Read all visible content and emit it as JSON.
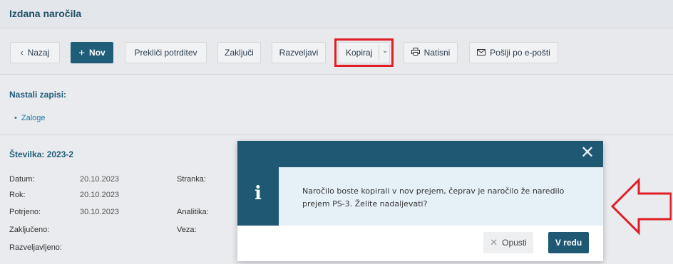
{
  "header": {
    "title": "Izdana naročila"
  },
  "toolbar": {
    "back_label": "Nazaj",
    "new_label": "Nov",
    "cancel_confirm_label": "Prekliči potrditev",
    "close_label": "Zaključi",
    "revert_label": "Razveljavi",
    "copy_label": "Kopiraj",
    "print_label": "Natisni",
    "email_label": "Pošlji po e-pošti"
  },
  "records": {
    "title": "Nastali zapisi:",
    "items": [
      "Zaloge"
    ]
  },
  "document": {
    "number": "Številka: 2023-2",
    "fields": [
      {
        "label": "Datum:",
        "value": "20.10.2023"
      },
      {
        "label": "Rok:",
        "value": "20.10.2023"
      },
      {
        "label": "Potrjeno:",
        "value": "30.10.2023"
      },
      {
        "label": "Zaključeno:",
        "value": ""
      },
      {
        "label": "Razveljavljeno:",
        "value": ""
      }
    ],
    "right_labels": [
      "Stranka:",
      "Analitika:",
      "Veza:"
    ]
  },
  "dialog": {
    "close_glyph": "✕",
    "icon_glyph": "i",
    "message": "Naročilo boste kopirali v nov prejem, čeprav je naročilo že naredilo prejem PS-3. Želite nadaljevati?",
    "cancel_label": "Opusti",
    "ok_label": "V redu"
  },
  "colors": {
    "brand": "#1e5872",
    "highlight": "#e01e26",
    "link": "#1f7aa3"
  }
}
